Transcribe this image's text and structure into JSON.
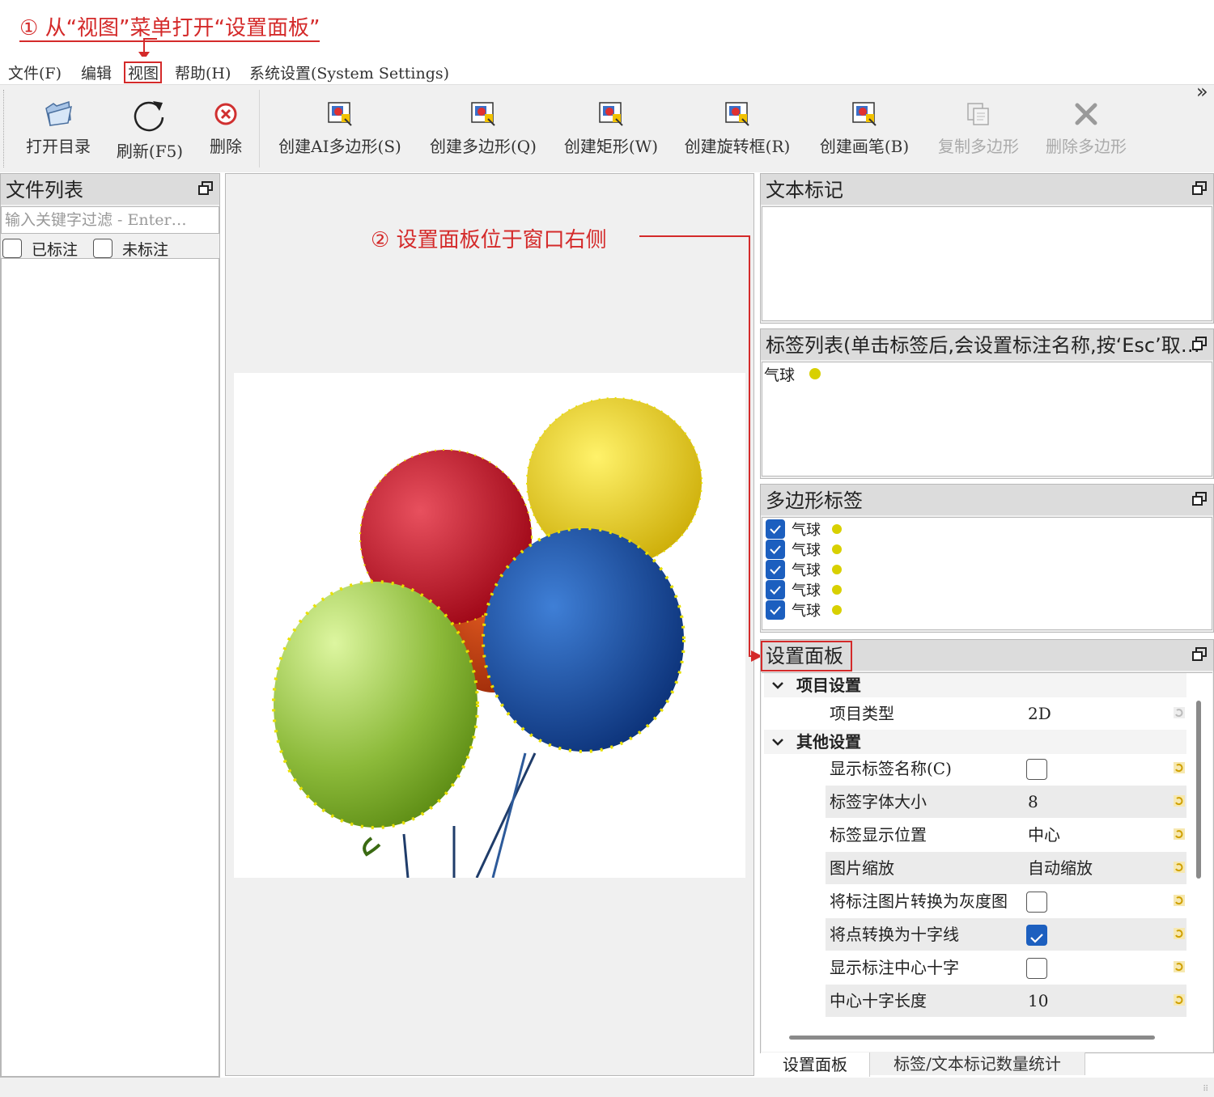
{
  "annotations": {
    "step1": "① 从“视图”菜单打开“设置面板”",
    "step2": "② 设置面板位于窗口右侧"
  },
  "menubar": {
    "items": [
      "文件(F)",
      "编辑",
      "视图",
      "帮助(H)",
      "系统设置(System Settings)"
    ]
  },
  "toolbar": {
    "items": [
      {
        "label": "打开目录",
        "icon": "folder-icon"
      },
      {
        "label": "刷新(F5)",
        "icon": "refresh-icon"
      },
      {
        "label": "删除",
        "icon": "delete-icon"
      },
      {
        "label": "创建AI多边形(S)",
        "icon": "create-ai-polygon-icon"
      },
      {
        "label": "创建多边形(Q)",
        "icon": "create-polygon-icon"
      },
      {
        "label": "创建矩形(W)",
        "icon": "create-rectangle-icon"
      },
      {
        "label": "创建旋转框(R)",
        "icon": "create-rotated-box-icon"
      },
      {
        "label": "创建画笔(B)",
        "icon": "create-brush-icon"
      },
      {
        "label": "复制多边形",
        "icon": "copy-polygon-icon",
        "disabled": true
      },
      {
        "label": "删除多边形",
        "icon": "delete-polygon-icon",
        "disabled": true
      }
    ],
    "overflow": "»"
  },
  "file_panel": {
    "title": "文件列表",
    "filter_placeholder": "输入关键字过滤 - Enter键搜索",
    "filter_shown": "输入关键字过滤 - Enter…",
    "labeled": "已标注",
    "unlabeled": "未标注"
  },
  "text_panel": {
    "title": "文本标记"
  },
  "label_panel": {
    "title": "标签列表(单击标签后,会设置标注名称,按‘Esc’取…",
    "items": [
      {
        "name": "气球",
        "color": "#d8d000"
      }
    ]
  },
  "polygon_panel": {
    "title": "多边形标签",
    "items": [
      {
        "name": "气球",
        "checked": true
      },
      {
        "name": "气球",
        "checked": true
      },
      {
        "name": "气球",
        "checked": true
      },
      {
        "name": "气球",
        "checked": true
      },
      {
        "name": "气球",
        "checked": true
      }
    ]
  },
  "settings_panel": {
    "title": "设置面板",
    "groups": [
      {
        "name": "项目设置"
      },
      {
        "name": "其他设置"
      }
    ],
    "rows": [
      {
        "name": "项目类型",
        "value": "2D",
        "type": "text"
      },
      {
        "name": "显示标签名称(C)",
        "checked": false,
        "type": "check"
      },
      {
        "name": "标签字体大小",
        "value": "8",
        "type": "text"
      },
      {
        "name": "标签显示位置",
        "value": "中心",
        "type": "text"
      },
      {
        "name": "图片缩放",
        "value": "自动缩放",
        "type": "text"
      },
      {
        "name": "将标注图片转换为灰度图",
        "checked": false,
        "type": "check"
      },
      {
        "name": "将点转换为十字线",
        "checked": true,
        "type": "check"
      },
      {
        "name": "显示标注中心十字",
        "checked": false,
        "type": "check"
      },
      {
        "name": "中心十字长度",
        "value": "10",
        "type": "text"
      }
    ]
  },
  "bottom_tabs": [
    "设置面板",
    "标签/文本标记数量统计"
  ],
  "colors": {
    "accent": "#d42a2a",
    "check": "#1c5fbf",
    "label": "#d8d000"
  }
}
